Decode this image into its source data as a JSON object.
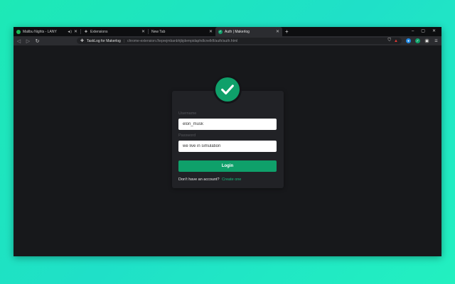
{
  "tabs": [
    {
      "title": "Malibu Nights - LANY",
      "fav_color": "#1db954",
      "extra": "◄)",
      "active": false
    },
    {
      "title": "Extensions",
      "fav_color": "#cccccc",
      "active": false
    },
    {
      "title": "New Tab",
      "fav_color": "",
      "active": false
    },
    {
      "title": "Auth | Makerlog",
      "fav_color": "#0fa06a",
      "active": true
    }
  ],
  "window_controls": {
    "minimize": "–",
    "maximize": "▢",
    "close": "✕"
  },
  "new_tab_label": "+",
  "omnibox": {
    "site": "TaskLog for Makerlog",
    "url": "chrome-extension://ieprejmbanbhjbjdempidaphdlcnelkfl/auth/auth.html"
  },
  "form": {
    "username_label": "Username",
    "username_value": "elon_musk",
    "password_label": "Password",
    "password_value": "we live in simulation",
    "login_label": "Login",
    "no_account_text": "Don't have an account?",
    "create_link": "Create one"
  },
  "colors": {
    "accent": "#0fa06a",
    "background": "#17181b",
    "card": "#212226"
  }
}
